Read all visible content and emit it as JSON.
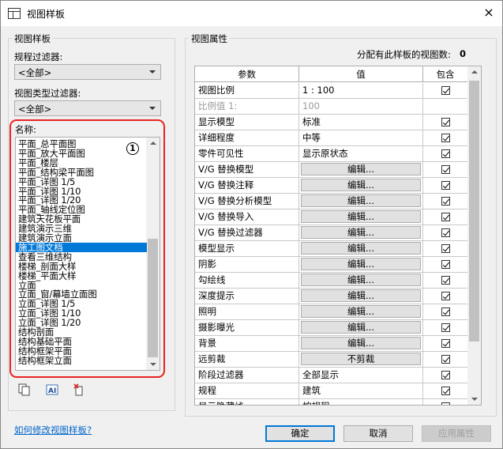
{
  "window": {
    "title": "视图样板",
    "close_icon": "×"
  },
  "left_group": {
    "label": "视图样板",
    "discipline_filter_label": "规程过滤器:",
    "discipline_filter_value": "<全部>",
    "view_type_filter_label": "视图类型过滤器:",
    "view_type_filter_value": "<全部>",
    "names_label": "名称:",
    "marker": "1",
    "names": [
      "平面_总平面图",
      "平面_放大平面图",
      "平面_楼层",
      "平面_结构梁平面图",
      "平面_详图 1/5",
      "平面_详图 1/10",
      "平面_详图 1/20",
      "平面_轴线定位图",
      "建筑天花板平面",
      "建筑演示三维",
      "建筑演示立面",
      "施工图文档",
      "查看三维结构",
      "楼梯_剖面大样",
      "楼梯_平面大样",
      "立面",
      "立面_窗/幕墙立面图",
      "立面_详图 1/5",
      "立面_详图 1/10",
      "立面_详图 1/20",
      "结构剖面",
      "结构基础平面",
      "结构框架平面",
      "结构框架立面"
    ],
    "selected_index": 11
  },
  "right_group": {
    "label": "视图属性",
    "assigned_count_label": "分配有此样板的视图数:",
    "assigned_count": "0",
    "columns": [
      "参数",
      "值",
      "包含"
    ],
    "rows": [
      {
        "param": "视图比例",
        "value": "1 : 100",
        "type": "text",
        "include": true
      },
      {
        "param": "比例值 1:",
        "value": "100",
        "type": "disabled",
        "include": false
      },
      {
        "param": "显示模型",
        "value": "标准",
        "type": "text",
        "include": true
      },
      {
        "param": "详细程度",
        "value": "中等",
        "type": "text",
        "include": true
      },
      {
        "param": "零件可见性",
        "value": "显示原状态",
        "type": "text",
        "include": true
      },
      {
        "param": "V/G 替换模型",
        "value": "编辑...",
        "type": "button",
        "include": true
      },
      {
        "param": "V/G 替换注释",
        "value": "编辑...",
        "type": "button",
        "include": true
      },
      {
        "param": "V/G 替换分析模型",
        "value": "编辑...",
        "type": "button",
        "include": true
      },
      {
        "param": "V/G 替换导入",
        "value": "编辑...",
        "type": "button",
        "include": true
      },
      {
        "param": "V/G 替换过滤器",
        "value": "编辑...",
        "type": "button",
        "include": true
      },
      {
        "param": "模型显示",
        "value": "编辑...",
        "type": "button",
        "include": true
      },
      {
        "param": "阴影",
        "value": "编辑...",
        "type": "button",
        "include": true
      },
      {
        "param": "勾绘线",
        "value": "编辑...",
        "type": "button",
        "include": true
      },
      {
        "param": "深度提示",
        "value": "编辑...",
        "type": "button",
        "include": true
      },
      {
        "param": "照明",
        "value": "编辑...",
        "type": "button",
        "include": true
      },
      {
        "param": "摄影曝光",
        "value": "编辑...",
        "type": "button",
        "include": true
      },
      {
        "param": "背景",
        "value": "编辑...",
        "type": "button",
        "include": true
      },
      {
        "param": "远剪裁",
        "value": "不剪裁",
        "type": "button",
        "include": true
      },
      {
        "param": "阶段过滤器",
        "value": "全部显示",
        "type": "text",
        "include": true
      },
      {
        "param": "规程",
        "value": "建筑",
        "type": "text",
        "include": true
      },
      {
        "param": "显示隐藏线",
        "value": "按规程",
        "type": "text",
        "include": true
      }
    ]
  },
  "footer": {
    "help_link": "如何修改视图样板?",
    "ok_label": "确定",
    "cancel_label": "取消",
    "apply_label": "应用属性"
  },
  "icons": [
    "duplicate-icon",
    "rename-icon",
    "delete-icon"
  ]
}
